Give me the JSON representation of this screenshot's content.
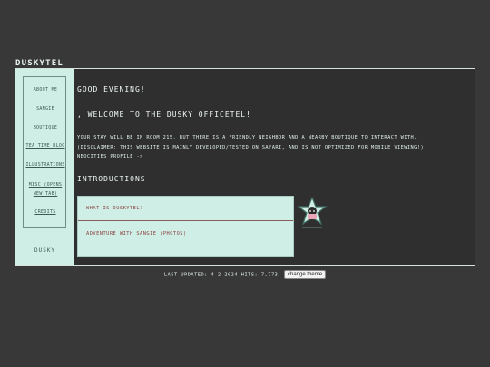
{
  "site": {
    "title": "DUSKYTEL"
  },
  "sidebar": {
    "nav": [
      {
        "label": "ABOUT ME"
      },
      {
        "label": "SANGIE"
      },
      {
        "label": "BOUTIQUE"
      },
      {
        "label": "TEA TIME BLOG"
      },
      {
        "label": "ILLUSTRATIONS"
      },
      {
        "label": "MISC (OPENS NEW TAB)"
      },
      {
        "label": "CREDITS"
      }
    ],
    "footer": "DUSKY"
  },
  "main": {
    "greeting": "GOOD EVENING!",
    "welcome": ", WELCOME TO THE DUSKY OFFICETEL!",
    "body_line1": "YOUR STAY WILL BE IN ROOM 215. BUT THERE IS A FRIENDLY NEIGHBOR AND A NEARBY BOUTIQUE TO INTERACT WITH.",
    "body_line2": "(DISCLAIMER: THIS WEBSITE IS MAINLY DEVELOPED/TESTED ON SAFARI, AND IS NOT OPTIMIZED FOR MOBILE VIEWING!)",
    "profile_link": "NEOCITIES PROFILE ->",
    "section_title": "INTRODUCTIONS",
    "cards": [
      {
        "label": "WHAT IS DUSKYTEL?"
      },
      {
        "label": "ADVENTURE WITH SANGIE (PHOTOS)"
      }
    ]
  },
  "footer": {
    "updated": "LAST UPDATED: 4-2-2024 HITS: 7,773",
    "theme_button": "change theme"
  },
  "colors": {
    "background": "#383838",
    "panel": "#cfeee5",
    "text": "#e9f5ef",
    "card_text": "#8b3f3f"
  }
}
